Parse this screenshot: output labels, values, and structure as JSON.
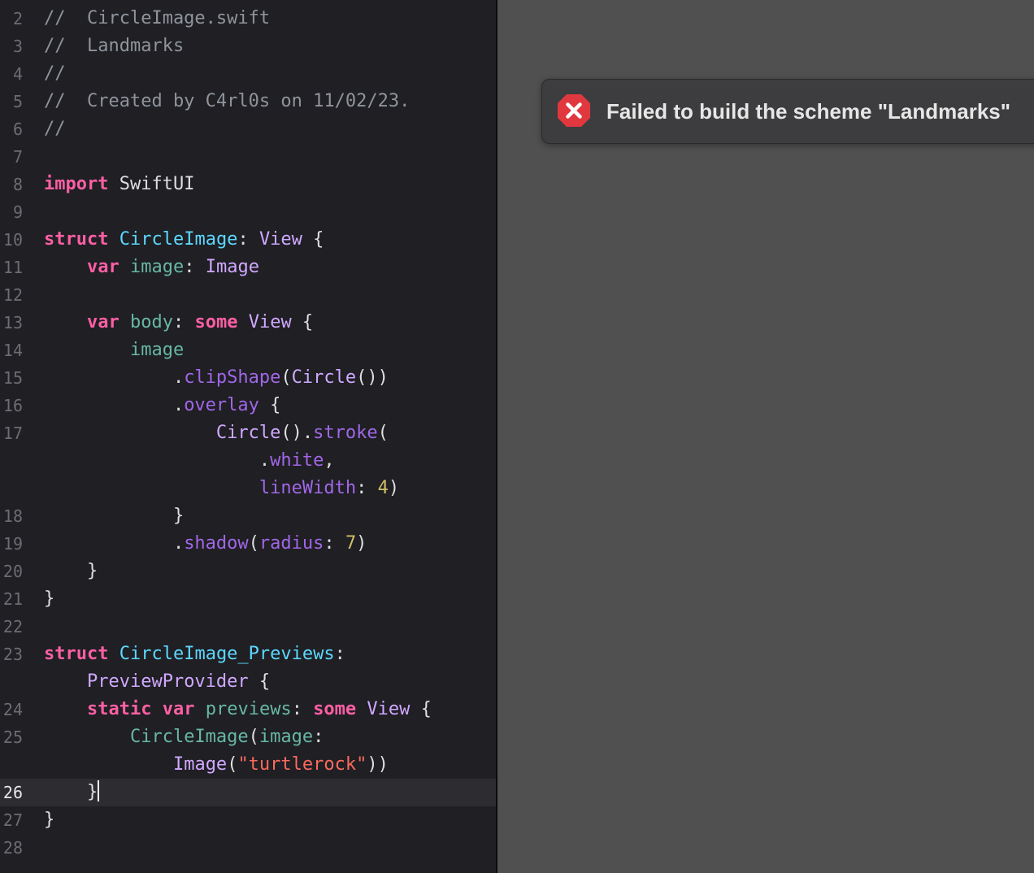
{
  "editor": {
    "file_comment": "//  CircleImage.swift",
    "lines": [
      {
        "n": "2",
        "tokens": [
          {
            "t": "//  CircleImage.swift",
            "k": "comment"
          }
        ]
      },
      {
        "n": "3",
        "tokens": [
          {
            "t": "//  Landmarks",
            "k": "comment"
          }
        ]
      },
      {
        "n": "4",
        "tokens": [
          {
            "t": "//",
            "k": "comment"
          }
        ]
      },
      {
        "n": "5",
        "tokens": [
          {
            "t": "//  Created by C4rl0s on 11/02/23.",
            "k": "comment"
          }
        ]
      },
      {
        "n": "6",
        "tokens": [
          {
            "t": "//",
            "k": "comment"
          }
        ]
      },
      {
        "n": "7",
        "tokens": []
      },
      {
        "n": "8",
        "tokens": [
          {
            "t": "import",
            "k": "kw"
          },
          {
            "t": " SwiftUI",
            "k": "plain"
          }
        ]
      },
      {
        "n": "9",
        "tokens": []
      },
      {
        "n": "10",
        "tokens": [
          {
            "t": "struct",
            "k": "kw"
          },
          {
            "t": " ",
            "k": "plain"
          },
          {
            "t": "CircleImage",
            "k": "type"
          },
          {
            "t": ": ",
            "k": "plain"
          },
          {
            "t": "View",
            "k": "sys"
          },
          {
            "t": " {",
            "k": "plain"
          }
        ]
      },
      {
        "n": "11",
        "tokens": [
          {
            "t": "    ",
            "k": "plain"
          },
          {
            "t": "var",
            "k": "kw"
          },
          {
            "t": " ",
            "k": "plain"
          },
          {
            "t": "image",
            "k": "prop"
          },
          {
            "t": ": ",
            "k": "plain"
          },
          {
            "t": "Image",
            "k": "sys"
          }
        ]
      },
      {
        "n": "12",
        "tokens": []
      },
      {
        "n": "13",
        "tokens": [
          {
            "t": "    ",
            "k": "plain"
          },
          {
            "t": "var",
            "k": "kw"
          },
          {
            "t": " ",
            "k": "plain"
          },
          {
            "t": "body",
            "k": "prop"
          },
          {
            "t": ": ",
            "k": "plain"
          },
          {
            "t": "some",
            "k": "kw"
          },
          {
            "t": " ",
            "k": "plain"
          },
          {
            "t": "View",
            "k": "sys"
          },
          {
            "t": " {",
            "k": "plain"
          }
        ]
      },
      {
        "n": "14",
        "tokens": [
          {
            "t": "        ",
            "k": "plain"
          },
          {
            "t": "image",
            "k": "prop"
          }
        ]
      },
      {
        "n": "15",
        "tokens": [
          {
            "t": "            .",
            "k": "plain"
          },
          {
            "t": "clipShape",
            "k": "sysfn"
          },
          {
            "t": "(",
            "k": "plain"
          },
          {
            "t": "Circle",
            "k": "sys"
          },
          {
            "t": "())",
            "k": "plain"
          }
        ]
      },
      {
        "n": "16",
        "tokens": [
          {
            "t": "            .",
            "k": "plain"
          },
          {
            "t": "overlay",
            "k": "sysfn"
          },
          {
            "t": " {",
            "k": "plain"
          }
        ]
      },
      {
        "n": "17",
        "tokens": [
          {
            "t": "                ",
            "k": "plain"
          },
          {
            "t": "Circle",
            "k": "sys"
          },
          {
            "t": "().",
            "k": "plain"
          },
          {
            "t": "stroke",
            "k": "sysfn"
          },
          {
            "t": "(",
            "k": "plain"
          }
        ]
      },
      {
        "n": "",
        "tokens": [
          {
            "t": "                    .",
            "k": "plain"
          },
          {
            "t": "white",
            "k": "sysfn"
          },
          {
            "t": ",",
            "k": "plain"
          }
        ]
      },
      {
        "n": "",
        "tokens": [
          {
            "t": "                    ",
            "k": "plain"
          },
          {
            "t": "lineWidth",
            "k": "sysfn"
          },
          {
            "t": ": ",
            "k": "plain"
          },
          {
            "t": "4",
            "k": "num"
          },
          {
            "t": ")",
            "k": "plain"
          }
        ]
      },
      {
        "n": "18",
        "tokens": [
          {
            "t": "            }",
            "k": "plain"
          }
        ]
      },
      {
        "n": "19",
        "tokens": [
          {
            "t": "            .",
            "k": "plain"
          },
          {
            "t": "shadow",
            "k": "sysfn"
          },
          {
            "t": "(",
            "k": "plain"
          },
          {
            "t": "radius",
            "k": "sysfn"
          },
          {
            "t": ": ",
            "k": "plain"
          },
          {
            "t": "7",
            "k": "num"
          },
          {
            "t": ")",
            "k": "plain"
          }
        ]
      },
      {
        "n": "20",
        "tokens": [
          {
            "t": "    }",
            "k": "plain"
          }
        ]
      },
      {
        "n": "21",
        "tokens": [
          {
            "t": "}",
            "k": "plain"
          }
        ]
      },
      {
        "n": "22",
        "tokens": []
      },
      {
        "n": "23",
        "tokens": [
          {
            "t": "struct",
            "k": "kw"
          },
          {
            "t": " ",
            "k": "plain"
          },
          {
            "t": "CircleImage_Previews",
            "k": "type"
          },
          {
            "t": ":",
            "k": "plain"
          }
        ]
      },
      {
        "n": "",
        "tokens": [
          {
            "t": "    ",
            "k": "plain"
          },
          {
            "t": "PreviewProvider",
            "k": "sys"
          },
          {
            "t": " {",
            "k": "plain"
          }
        ]
      },
      {
        "n": "24",
        "tokens": [
          {
            "t": "    ",
            "k": "plain"
          },
          {
            "t": "static",
            "k": "kw"
          },
          {
            "t": " ",
            "k": "plain"
          },
          {
            "t": "var",
            "k": "kw"
          },
          {
            "t": " ",
            "k": "plain"
          },
          {
            "t": "previews",
            "k": "prop"
          },
          {
            "t": ": ",
            "k": "plain"
          },
          {
            "t": "some",
            "k": "kw"
          },
          {
            "t": " ",
            "k": "plain"
          },
          {
            "t": "View",
            "k": "sys"
          },
          {
            "t": " {",
            "k": "plain"
          }
        ]
      },
      {
        "n": "25",
        "tokens": [
          {
            "t": "        ",
            "k": "plain"
          },
          {
            "t": "CircleImage",
            "k": "prop"
          },
          {
            "t": "(",
            "k": "plain"
          },
          {
            "t": "image",
            "k": "prop"
          },
          {
            "t": ":",
            "k": "plain"
          }
        ]
      },
      {
        "n": "",
        "tokens": [
          {
            "t": "            ",
            "k": "plain"
          },
          {
            "t": "Image",
            "k": "sys"
          },
          {
            "t": "(",
            "k": "plain"
          },
          {
            "t": "\"turtlerock\"",
            "k": "str"
          },
          {
            "t": "))",
            "k": "plain"
          }
        ]
      },
      {
        "n": "26",
        "current": true,
        "tokens": [
          {
            "t": "    }",
            "k": "plain"
          }
        ]
      },
      {
        "n": "27",
        "tokens": [
          {
            "t": "}",
            "k": "plain"
          }
        ]
      },
      {
        "n": "28",
        "tokens": []
      }
    ]
  },
  "toast": {
    "icon": "error-x-circle-icon",
    "message": "Failed to build the scheme \"Landmarks\"",
    "icon_color": "#e0383e"
  },
  "colors": {
    "editor_background": "#1f1f24",
    "preview_background": "#505050",
    "keyword": "#fc5fa3",
    "type": "#5dd8ff",
    "comment": "#8f949b"
  }
}
